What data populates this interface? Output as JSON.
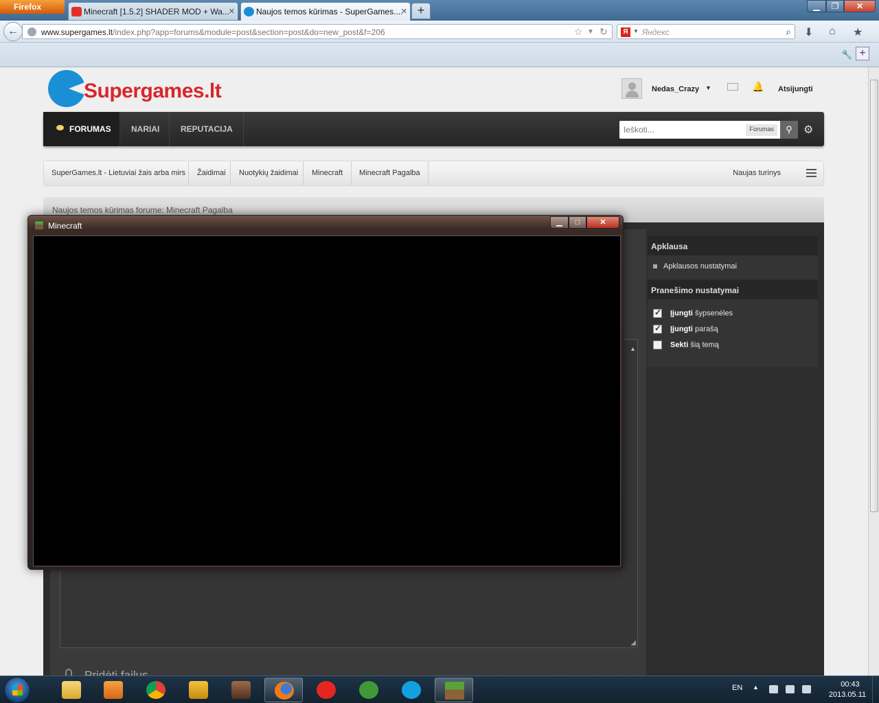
{
  "browser": {
    "menu_label": "Firefox",
    "tabs": [
      {
        "label": "Minecraft [1.5.2] SHADER MOD + Wa...",
        "icon": "youtube-icon"
      },
      {
        "label": "Naujos temos kūrimas - SuperGames....",
        "icon": "supergames-icon"
      }
    ],
    "new_tab": "+",
    "url_host": "www.supergames.lt",
    "url_path": "/index.php?app=forums&module=post&section=post&do=new_post&f=206",
    "search_engine": "Я",
    "search_placeholder": "Яндекс"
  },
  "site": {
    "logo_text": "Supergames.lt",
    "username": "Nedas_Crazy",
    "logout": "Atsijungti",
    "nav": [
      "FORUMAS",
      "NARIAI",
      "REPUTACIJA"
    ],
    "search_placeholder": "Ieškoti...",
    "search_scope": "Forumas",
    "breadcrumb": [
      "SuperGames.lt - Lietuviai žais arba mirs",
      "Žaidimai",
      "Nuotykių žaidimai",
      "Minecraft",
      "Minecraft Pagalba"
    ],
    "new_content": "Naujas turinys",
    "page_title": "Naujos temos kūrimas forume: Minecraft Pagalba",
    "add_files": "Pridėti failus",
    "sidebar": {
      "poll_head": "Apklausa",
      "poll_settings": "Apklausos nustatymai",
      "post_head": "Pranešimo nustatymai",
      "options": [
        {
          "bold": "Įjungti",
          "rest": " šypsenėles",
          "checked": true
        },
        {
          "bold": "Įjungti",
          "rest": " parašą",
          "checked": true
        },
        {
          "bold": "Sekti",
          "rest": " šią temą",
          "checked": false
        }
      ]
    }
  },
  "minecraft_window": {
    "title": "Minecraft",
    "close": "✕"
  },
  "taskbar": {
    "apps": [
      "explorer",
      "media-player",
      "chrome",
      "winamp",
      "game",
      "firefox",
      "yandex",
      "utorrent",
      "skype",
      "minecraft"
    ],
    "lang": "EN",
    "time": "00:43",
    "date": "2013.05.11"
  }
}
